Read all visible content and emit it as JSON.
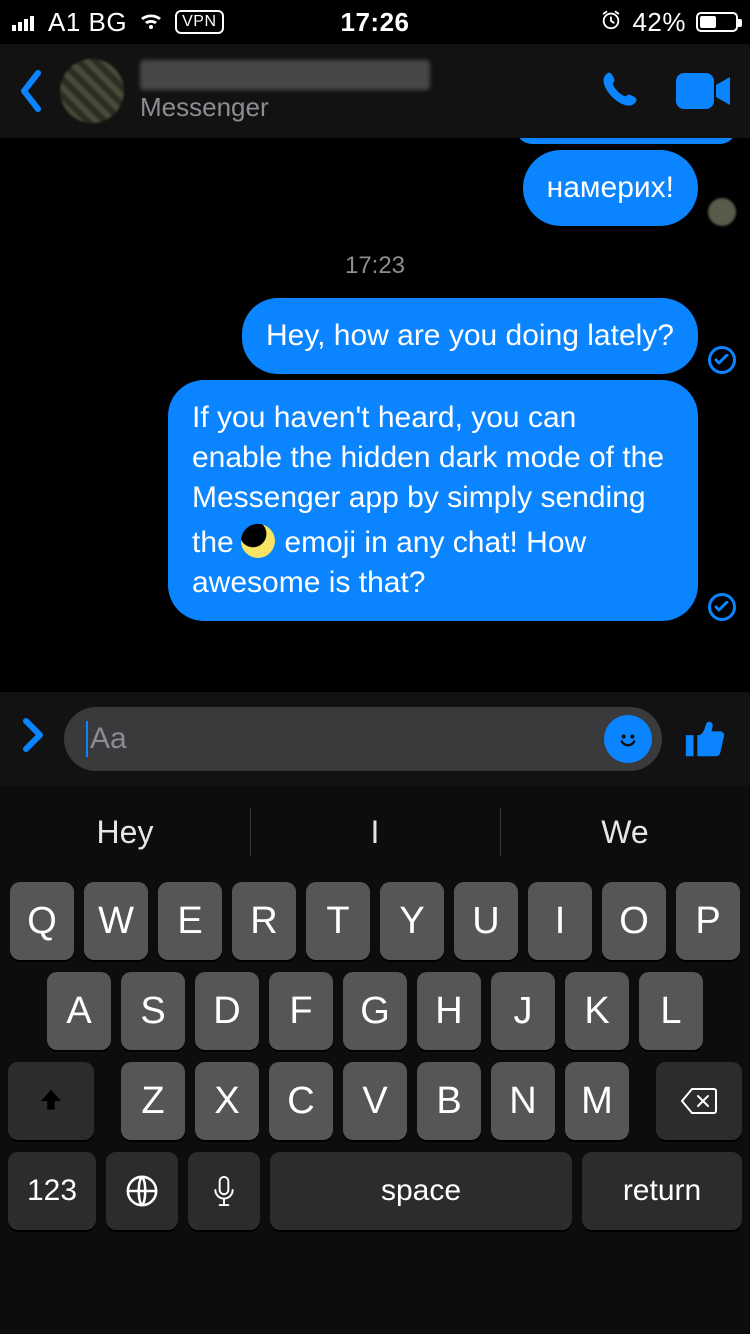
{
  "status": {
    "carrier": "A1 BG",
    "vpn": "VPN",
    "time": "17:26",
    "battery_pct_text": "42%",
    "battery_pct": 42
  },
  "header": {
    "contact_name_redacted": true,
    "subtitle": "Messenger"
  },
  "conversation": {
    "bubble_prev": "намерих!",
    "timestamp": "17:23",
    "bubble1": "Hey, how are you doing lately?",
    "bubble2_before": "If you haven't heard, you can enable the hidden dark mode of the Messenger app by simply sending the ",
    "bubble2_after": " emoji in any chat! How awesome is that?"
  },
  "composer": {
    "placeholder": "Aa"
  },
  "keyboard": {
    "suggestions": [
      "Hey",
      "I",
      "We"
    ],
    "row1": [
      "Q",
      "W",
      "E",
      "R",
      "T",
      "Y",
      "U",
      "I",
      "O",
      "P"
    ],
    "row2": [
      "A",
      "S",
      "D",
      "F",
      "G",
      "H",
      "J",
      "K",
      "L"
    ],
    "row3": [
      "Z",
      "X",
      "C",
      "V",
      "B",
      "N",
      "M"
    ],
    "num_label": "123",
    "space_label": "space",
    "return_label": "return"
  }
}
